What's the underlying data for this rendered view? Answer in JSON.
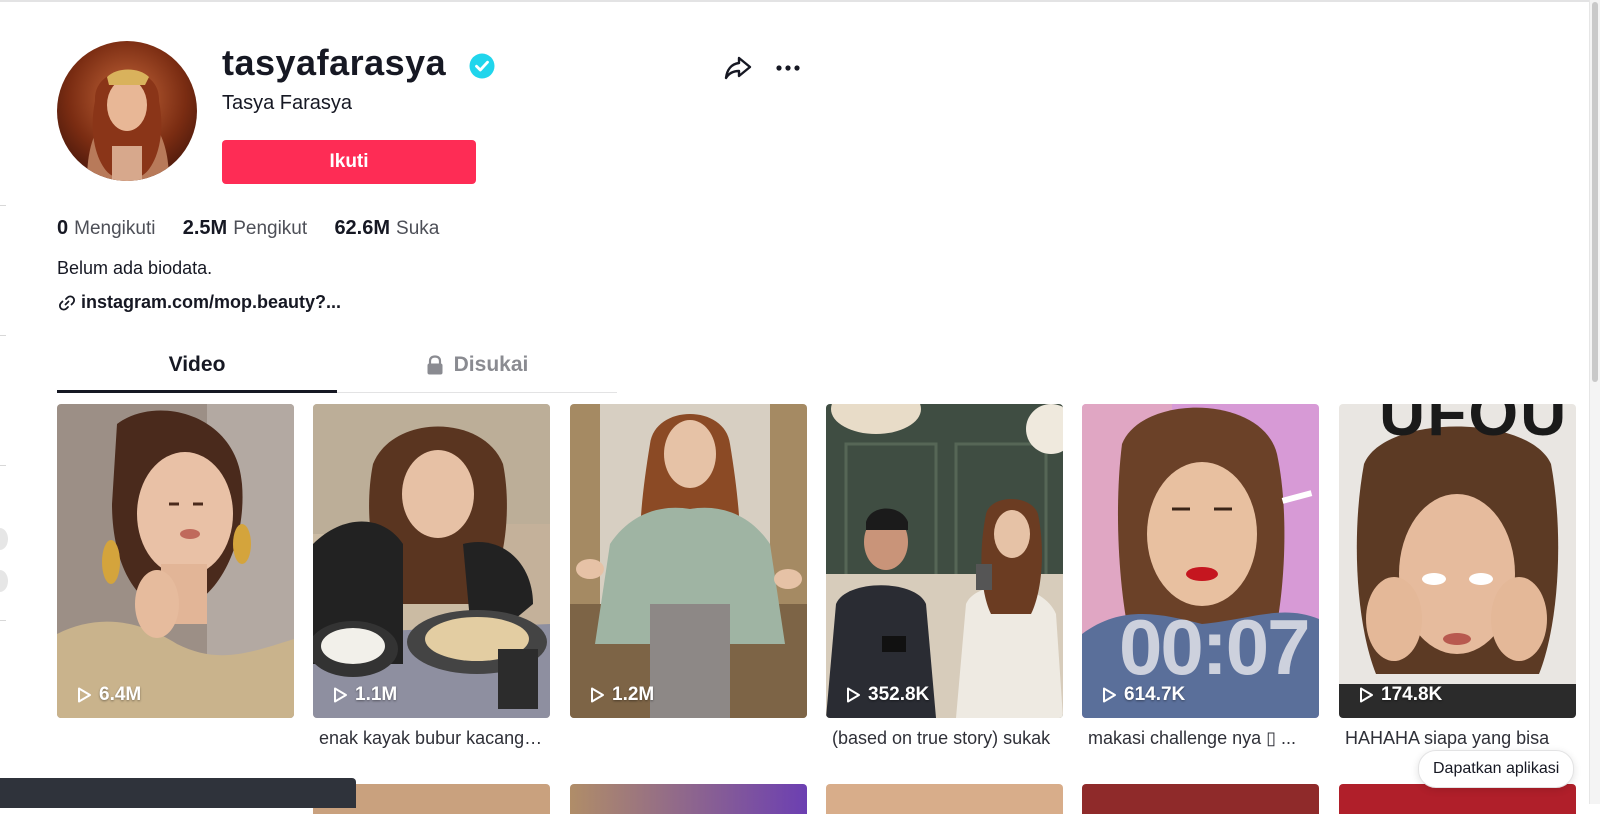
{
  "profile": {
    "username": "tasyafarasya",
    "nickname": "Tasya Farasya",
    "follow_label": "Ikuti",
    "verified_icon": "verified-badge-icon",
    "accent_color": "#fe2c55",
    "verified_color": "#20d5ec"
  },
  "stats": [
    {
      "value": "0",
      "label": "Mengikuti"
    },
    {
      "value": "2.5M",
      "label": "Pengikut"
    },
    {
      "value": "62.6M",
      "label": "Suka"
    }
  ],
  "bio": "Belum ada biodata.",
  "link": "instagram.com/mop.beauty?...",
  "tabs": [
    {
      "label": "Video",
      "active": true
    },
    {
      "label": "Disukai",
      "locked": true
    }
  ],
  "videos": [
    {
      "views": "6.4M",
      "caption": ""
    },
    {
      "views": "1.1M",
      "caption": "enak kayak bubur kacang ijo"
    },
    {
      "views": "1.2M",
      "caption": ""
    },
    {
      "views": "352.8K",
      "caption": "(based on true story) sukak"
    },
    {
      "views": "614.7K",
      "caption": "makasi challenge nya ▯ ...",
      "overlay": "00:07"
    },
    {
      "views": "174.8K",
      "caption": "HAHAHA siapa yang bisa",
      "overlay": "UFOU"
    }
  ],
  "get_app": "Dapatkan aplikasi"
}
